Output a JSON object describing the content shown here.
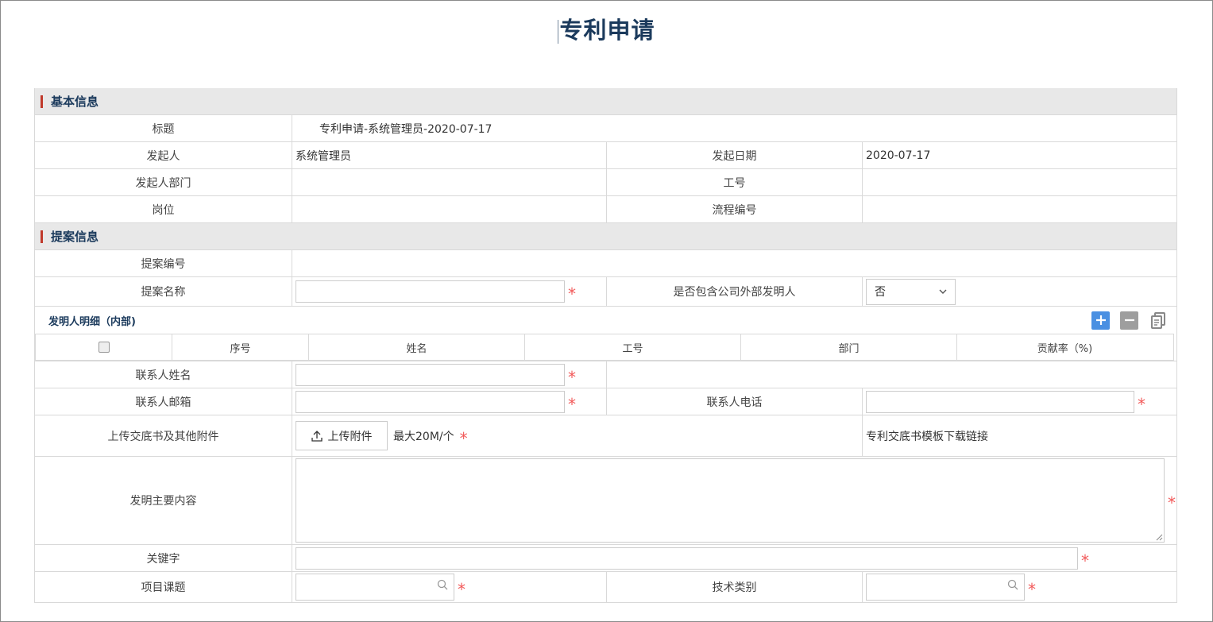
{
  "page": {
    "title": "专利申请"
  },
  "basic": {
    "section_title": "基本信息",
    "title_label": "标题",
    "title_value": "专利申请-系统管理员-2020-07-17",
    "initiator_label": "发起人",
    "initiator_value": "系统管理员",
    "start_date_label": "发起日期",
    "start_date_value": "2020-07-17",
    "dept_label": "发起人部门",
    "dept_value": "",
    "emp_no_label": "工号",
    "emp_no_value": "",
    "position_label": "岗位",
    "position_value": "",
    "flow_no_label": "流程编号",
    "flow_no_value": ""
  },
  "proposal": {
    "section_title": "提案信息",
    "proposal_no_label": "提案编号",
    "proposal_no_value": "",
    "proposal_name_label": "提案名称",
    "external_label": "是否包含公司外部发明人",
    "external_value": "否",
    "inventors_title": "发明人明细（内部)",
    "inventor_columns": [
      "序号",
      "姓名",
      "工号",
      "部门",
      "贡献率（%)"
    ],
    "contact_name_label": "联系人姓名",
    "contact_email_label": "联系人邮箱",
    "contact_phone_label": "联系人电话",
    "upload_label": "上传交底书及其他附件",
    "upload_button": "上传附件",
    "upload_hint": "最大20M/个",
    "template_link": "专利交底书模板下载链接",
    "content_label": "发明主要内容",
    "keywords_label": "关键字",
    "project_label": "项目课题",
    "tech_type_label": "技术类别"
  },
  "required_mark": "*",
  "colors": {
    "accent": "#1b3a5c",
    "section_bar": "#c0392b",
    "required": "#f25a5a",
    "add_button": "#4a90e2"
  }
}
